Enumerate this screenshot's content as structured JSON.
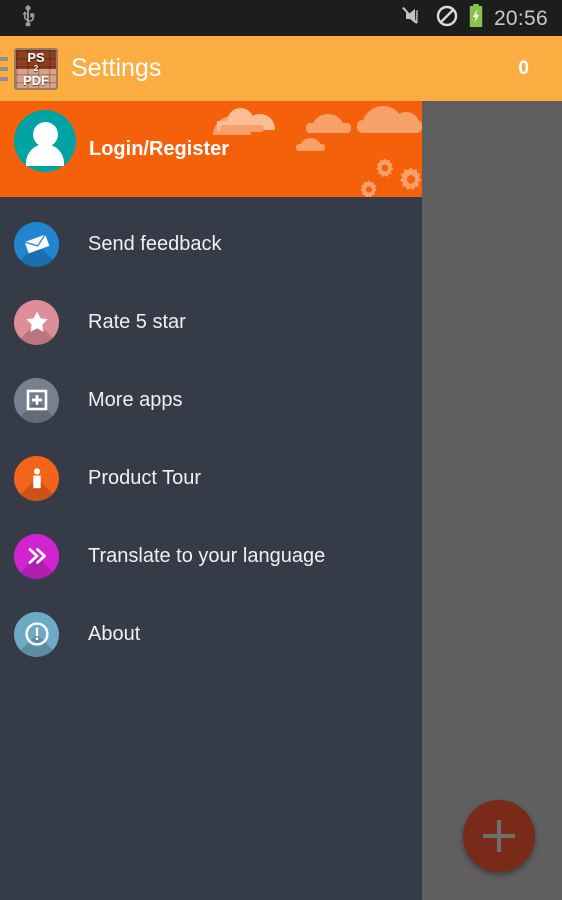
{
  "status_bar": {
    "usb_icon": "usb-icon",
    "icons": [
      "vibrate-off-icon",
      "do-not-disturb-icon",
      "battery-charging-icon"
    ],
    "clock": "20:56",
    "background": "#1d1d1d"
  },
  "action_bar": {
    "menu_icon": "hamburger-menu-icon",
    "app_icon": {
      "name": "ps2pdf-app-icon",
      "top_text": "PS",
      "mid_text": "2",
      "bottom_text": "PDF"
    },
    "title": "Settings",
    "count": "0",
    "background": "#fbad41"
  },
  "drawer": {
    "background": "#353c48",
    "header": {
      "label": "Login/Register",
      "avatar_icon": "user-avatar-icon",
      "background": "#f4610a",
      "decor": [
        "cloud-icon",
        "gear-icon"
      ]
    },
    "items": [
      {
        "label": "Send feedback",
        "icon": "envelope-icon",
        "color": "#2185d0"
      },
      {
        "label": "Rate 5 star",
        "icon": "star-icon",
        "color": "#dd8e96"
      },
      {
        "label": "More apps",
        "icon": "plus-square-icon",
        "color": "#78808f"
      },
      {
        "label": "Product Tour",
        "icon": "person-icon",
        "color": "#f4631a"
      },
      {
        "label": "Translate to your language",
        "icon": "double-chevron-icon",
        "color": "#d124d1"
      },
      {
        "label": "About",
        "icon": "exclamation-circle-icon",
        "color": "#6daac4"
      }
    ]
  },
  "content": {
    "scrim_color": "#5f5f5f",
    "fab": {
      "icon": "plus-icon",
      "color": "#7a2a18"
    }
  }
}
